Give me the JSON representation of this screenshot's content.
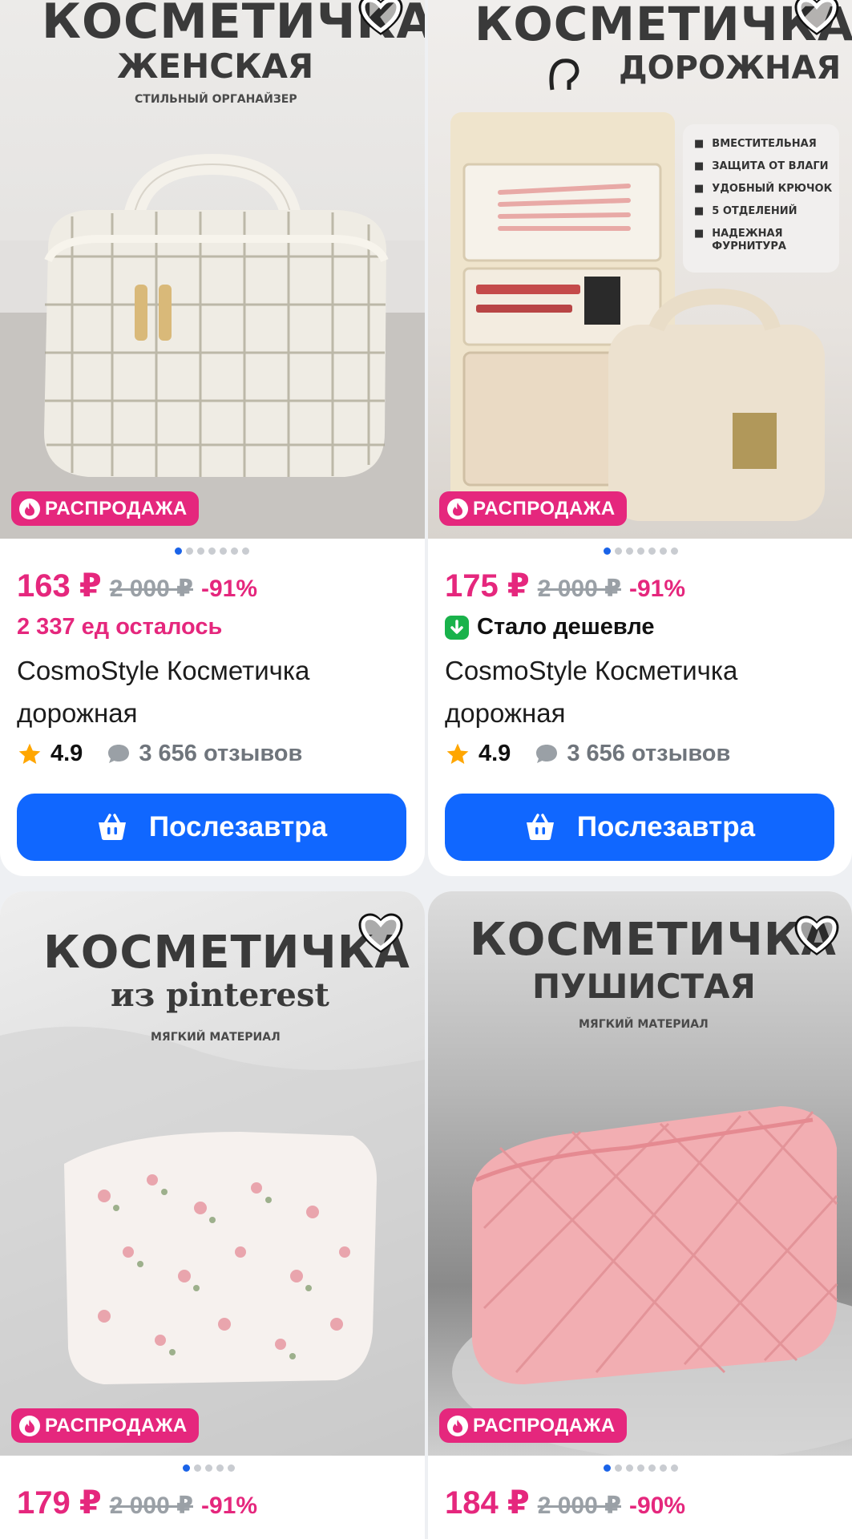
{
  "cards": [
    {
      "photo_title": "КОСМЕТИЧКА",
      "photo_subtitle": "ЖЕНСКАЯ",
      "photo_tagline": "СТИЛЬНЫЙ ОРГАНАЙЗЕР",
      "sale_label": "РАСПРОДАЖА",
      "price": "163 ₽",
      "old_price": "2 000 ₽",
      "discount": "-91%",
      "stock_text": "2 337 ед осталось",
      "name": "CosmoStyle Косметичка дорожная",
      "rating": "4.9",
      "reviews": "3 656 отзывов",
      "buy_label": "Послезавтра",
      "image_dots": 7,
      "favorited": false
    },
    {
      "photo_title": "КОСМЕТИЧКА",
      "photo_subtitle": "ДОРОЖНАЯ",
      "photo_features": [
        "ВМЕСТИТЕЛЬНАЯ",
        "ЗАЩИТА ОТ ВЛАГИ",
        "УДОБНЫЙ КРЮЧОК",
        "5 ОТДЕЛЕНИЙ",
        "НАДЕЖНАЯ ФУРНИТУРА"
      ],
      "sale_label": "РАСПРОДАЖА",
      "price": "175 ₽",
      "old_price": "2 000 ₽",
      "discount": "-91%",
      "cheaper_label": "Стало дешевле",
      "name": "CosmoStyle Косметичка дорожная",
      "rating": "4.9",
      "reviews": "3 656 отзывов",
      "buy_label": "Послезавтра",
      "image_dots": 7,
      "favorited": false
    },
    {
      "photo_title": "КОСМЕТИЧКА",
      "photo_subtitle": "из pinterest",
      "photo_tagline": "МЯГКИЙ МАТЕРИАЛ",
      "sale_label": "РАСПРОДАЖА",
      "price": "179 ₽",
      "old_price": "2 000 ₽",
      "discount": "-91%",
      "image_dots": 5,
      "favorited": false
    },
    {
      "photo_title": "КОСМЕТИЧКА",
      "photo_subtitle": "ПУШИСТАЯ",
      "photo_tagline": "МЯГКИЙ МАТЕРИАЛ",
      "sale_label": "РАСПРОДАЖА",
      "price": "184 ₽",
      "old_price": "2 000 ₽",
      "discount": "-90%",
      "image_dots": 7,
      "favorited": false
    }
  ],
  "colors": {
    "accent_pink": "#e5277d",
    "button_blue": "#1067ff",
    "dot_active": "#1a63e8",
    "green_badge": "#19b24b",
    "star": "#ffa600"
  },
  "icons": [
    "heart-outline-icon",
    "flame-icon",
    "star-icon",
    "comment-bubble-icon",
    "basket-icon",
    "arrow-down-icon"
  ]
}
